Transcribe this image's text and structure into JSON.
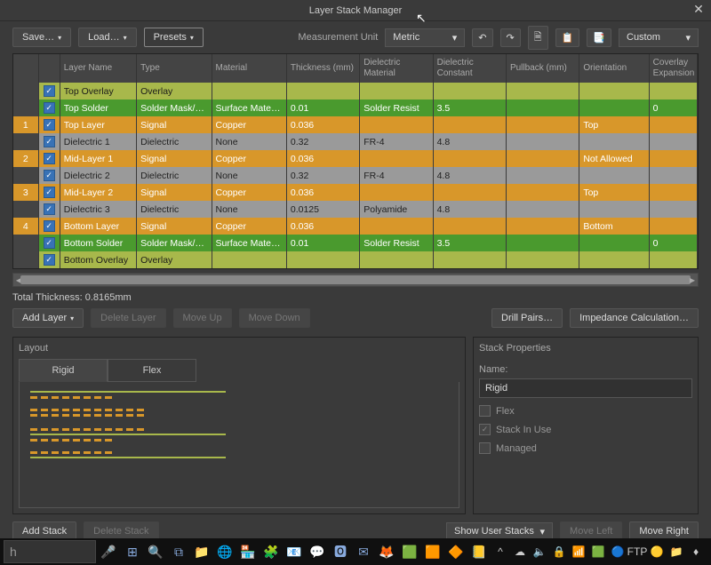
{
  "window": {
    "title": "Layer Stack Manager",
    "close": "✕"
  },
  "toolbar": {
    "save": "Save…",
    "load": "Load…",
    "presets": "Presets",
    "measurement_label": "Measurement Unit",
    "measurement_value": "Metric",
    "custom": "Custom"
  },
  "columns": [
    "",
    "",
    "Layer Name",
    "Type",
    "Material",
    "Thickness (mm)",
    "Dielectric Material",
    "Dielectric Constant",
    "Pullback (mm)",
    "Orientation",
    "Coverlay Expansion"
  ],
  "rows": [
    {
      "num": "",
      "cls": "yellow noNum",
      "name": "Top Overlay",
      "type": "Overlay",
      "material": "",
      "thickness": "",
      "diel": "",
      "dc": "",
      "pull": "",
      "orient": "",
      "cov": ""
    },
    {
      "num": "",
      "cls": "green noNum",
      "name": "Top Solder",
      "type": "Solder Mask/Co…",
      "material": "Surface Material",
      "thickness": "0.01",
      "diel": "Solder Resist",
      "dc": "3.5",
      "pull": "",
      "orient": "",
      "cov": "0"
    },
    {
      "num": "1",
      "cls": "orange",
      "name": "Top Layer",
      "type": "Signal",
      "material": "Copper",
      "thickness": "0.036",
      "diel": "",
      "dc": "",
      "pull": "",
      "orient": "Top",
      "cov": ""
    },
    {
      "num": "",
      "cls": "gray noNum",
      "name": "Dielectric 1",
      "type": "Dielectric",
      "material": "None",
      "thickness": "0.32",
      "diel": "FR-4",
      "dc": "4.8",
      "pull": "",
      "orient": "",
      "cov": ""
    },
    {
      "num": "2",
      "cls": "orange",
      "name": "Mid-Layer 1",
      "type": "Signal",
      "material": "Copper",
      "thickness": "0.036",
      "diel": "",
      "dc": "",
      "pull": "",
      "orient": "Not Allowed",
      "cov": ""
    },
    {
      "num": "",
      "cls": "gray noNum",
      "name": "Dielectric 2",
      "type": "Dielectric",
      "material": "None",
      "thickness": "0.32",
      "diel": "FR-4",
      "dc": "4.8",
      "pull": "",
      "orient": "",
      "cov": ""
    },
    {
      "num": "3",
      "cls": "orange",
      "name": "Mid-Layer 2",
      "type": "Signal",
      "material": "Copper",
      "thickness": "0.036",
      "diel": "",
      "dc": "",
      "pull": "",
      "orient": "Top",
      "cov": ""
    },
    {
      "num": "",
      "cls": "gray noNum",
      "name": "Dielectric 3",
      "type": "Dielectric",
      "material": "None",
      "thickness": "0.0125",
      "diel": "Polyamide",
      "dc": "4.8",
      "pull": "",
      "orient": "",
      "cov": ""
    },
    {
      "num": "4",
      "cls": "orange",
      "name": "Bottom Layer",
      "type": "Signal",
      "material": "Copper",
      "thickness": "0.036",
      "diel": "",
      "dc": "",
      "pull": "",
      "orient": "Bottom",
      "cov": ""
    },
    {
      "num": "",
      "cls": "green noNum",
      "name": "Bottom Solder",
      "type": "Solder Mask/Co…",
      "material": "Surface Material",
      "thickness": "0.01",
      "diel": "Solder Resist",
      "dc": "3.5",
      "pull": "",
      "orient": "",
      "cov": "0"
    },
    {
      "num": "",
      "cls": "yellow noNum",
      "name": "Bottom Overlay",
      "type": "Overlay",
      "material": "",
      "thickness": "",
      "diel": "",
      "dc": "",
      "pull": "",
      "orient": "",
      "cov": ""
    }
  ],
  "status": {
    "total_thickness": "Total Thickness: 0.8165mm"
  },
  "actions": {
    "add_layer": "Add Layer",
    "delete_layer": "Delete Layer",
    "move_up": "Move Up",
    "move_down": "Move Down",
    "drill_pairs": "Drill Pairs…",
    "impedance": "Impedance Calculation…"
  },
  "layout": {
    "title": "Layout",
    "tab_rigid": "Rigid",
    "tab_flex": "Flex",
    "add_stack": "Add Stack",
    "delete_stack": "Delete Stack",
    "show_user": "Show User Stacks",
    "move_left": "Move Left",
    "move_right": "Move Right"
  },
  "props": {
    "title": "Stack Properties",
    "name_label": "Name:",
    "name_value": "Rigid",
    "flex_label": "Flex",
    "stack_in_use": "Stack In Use",
    "managed": "Managed"
  },
  "taskbar": {
    "search": "h",
    "icons": [
      "⊞",
      "🔍",
      "⧉",
      "📁",
      "🌐",
      "🏪",
      "🧩",
      "📧",
      "💬",
      "🅾",
      "✉",
      "🦊",
      "🟩",
      "🟧",
      "🔶",
      "📒"
    ]
  },
  "tray": [
    "^",
    "☁",
    "🔈",
    "🔒",
    "📶",
    "🟩",
    "🔵",
    "FTP",
    "🟡",
    "📁",
    "♦"
  ]
}
